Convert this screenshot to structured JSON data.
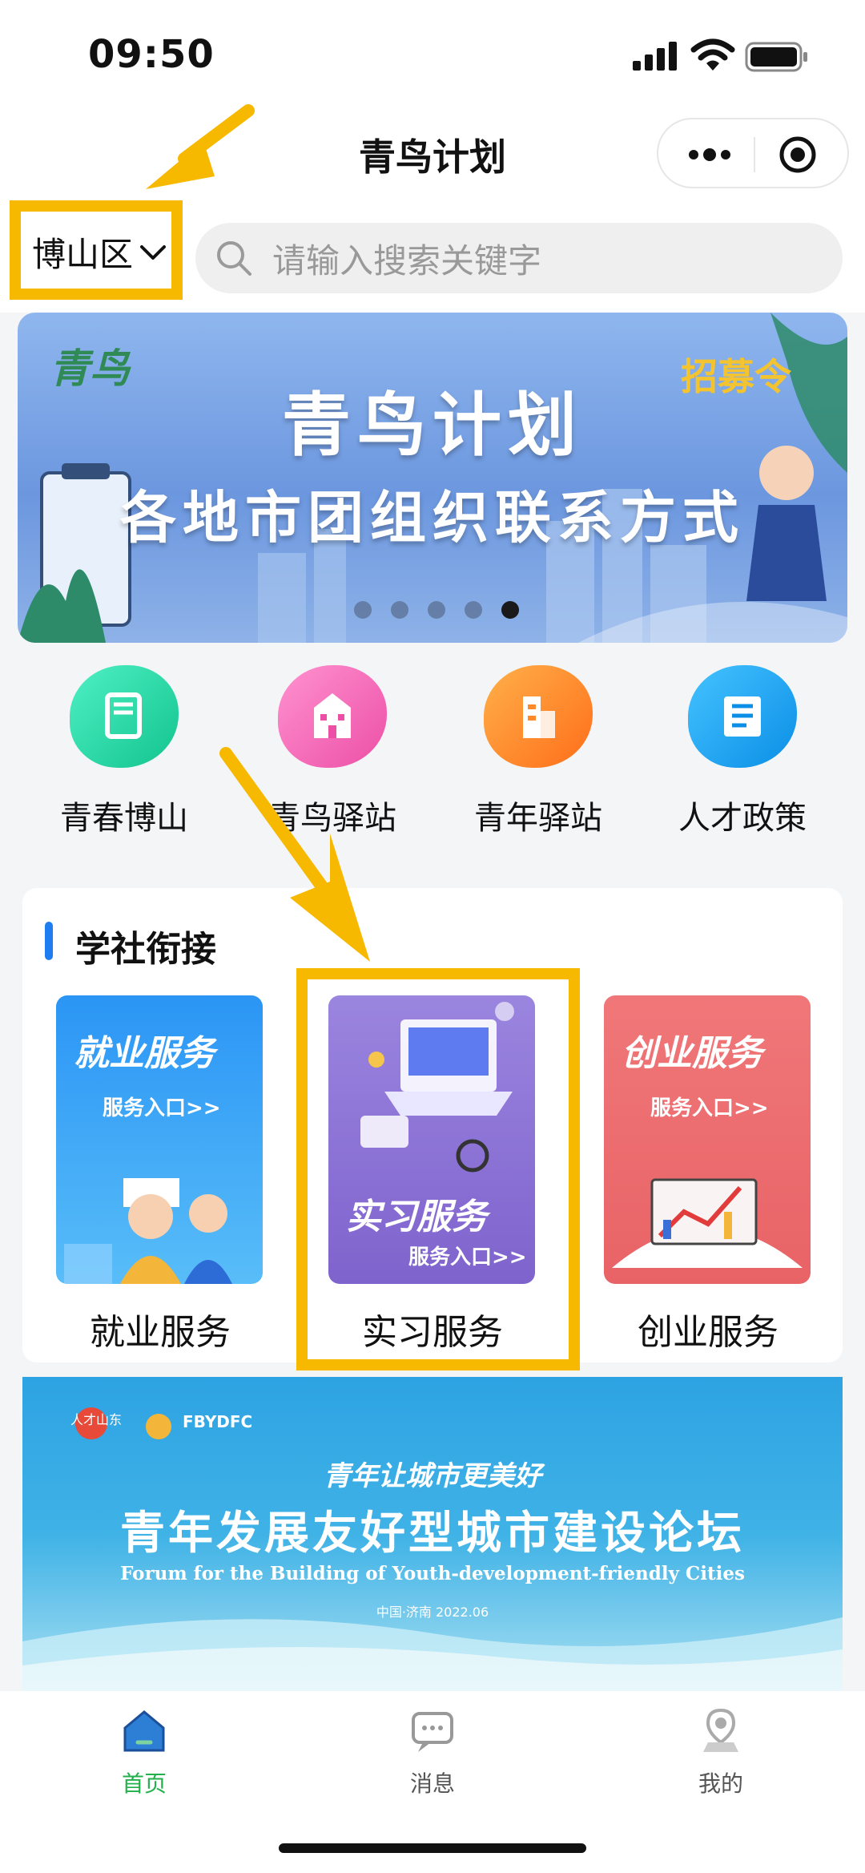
{
  "status_bar": {
    "time": "09:50"
  },
  "nav": {
    "title": "青鸟计划"
  },
  "location": {
    "label": "博山区"
  },
  "search": {
    "placeholder": "请输入搜索关键字"
  },
  "banner": {
    "logo": "青鸟",
    "tag": "招募令",
    "title": "青鸟计划",
    "subtitle": "各地市团组织联系方式",
    "dots": 5,
    "active_dot": 5
  },
  "quick_entries": [
    {
      "label": "青春博山",
      "icon": "book-icon",
      "color": "#27d8a6"
    },
    {
      "label": "青鸟驿站",
      "icon": "building-icon",
      "color": "#f26fb8"
    },
    {
      "label": "青年驿站",
      "icon": "office-icon",
      "color": "#ff8a2a"
    },
    {
      "label": "人才政策",
      "icon": "document-icon",
      "color": "#1aa3f5"
    }
  ],
  "link_section": {
    "title": "学社衔接",
    "services": [
      {
        "label": "就业服务",
        "poster_title": "就业服务",
        "poster_entry": "服务入口>>",
        "color": "#2d9cf2"
      },
      {
        "label": "实习服务",
        "poster_title": "实习服务",
        "poster_entry": "服务入口>>",
        "color": "#8d72d6"
      },
      {
        "label": "创业服务",
        "poster_title": "创业服务",
        "poster_entry": "服务入口>>",
        "color": "#ef6f73"
      }
    ]
  },
  "forum": {
    "logo_left": "人才山东",
    "logo_right": "FBYDFC",
    "slogan": "青年让城市更美好",
    "title": "青年发展友好型城市建设论坛",
    "subtitle_en": "Forum for the Building of Youth-development-friendly Cities",
    "date": "中国·济南 2022.06"
  },
  "tabs": [
    {
      "label": "首页",
      "icon": "home-icon",
      "active": true
    },
    {
      "label": "消息",
      "icon": "message-icon",
      "active": false
    },
    {
      "label": "我的",
      "icon": "profile-icon",
      "active": false
    }
  ],
  "colors": {
    "highlight": "#f7b800",
    "accent_green": "#22b04a",
    "accent_blue": "#1e7df0"
  }
}
